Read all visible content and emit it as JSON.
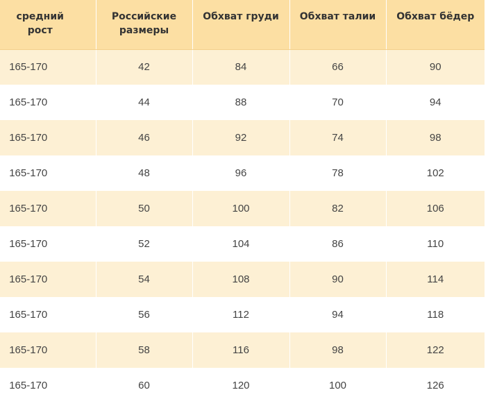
{
  "table": {
    "headers": [
      "средний рост",
      "Российские размеры",
      "Обхват груди",
      "Обхват талии",
      "Обхват бёдер"
    ],
    "rows": [
      [
        "165-170",
        "42",
        "84",
        "66",
        "90"
      ],
      [
        "165-170",
        "44",
        "88",
        "70",
        "94"
      ],
      [
        "165-170",
        "46",
        "92",
        "74",
        "98"
      ],
      [
        "165-170",
        "48",
        "96",
        "78",
        "102"
      ],
      [
        "165-170",
        "50",
        "100",
        "82",
        "106"
      ],
      [
        "165-170",
        "52",
        "104",
        "86",
        "110"
      ],
      [
        "165-170",
        "54",
        "108",
        "90",
        "114"
      ],
      [
        "165-170",
        "56",
        "112",
        "94",
        "118"
      ],
      [
        "165-170",
        "58",
        "116",
        "98",
        "122"
      ],
      [
        "165-170",
        "60",
        "120",
        "100",
        "126"
      ]
    ]
  },
  "colors": {
    "header_background": "#fcdfa3",
    "shaded_row": "#fdf0d4",
    "plain_row": "#ffffff"
  }
}
